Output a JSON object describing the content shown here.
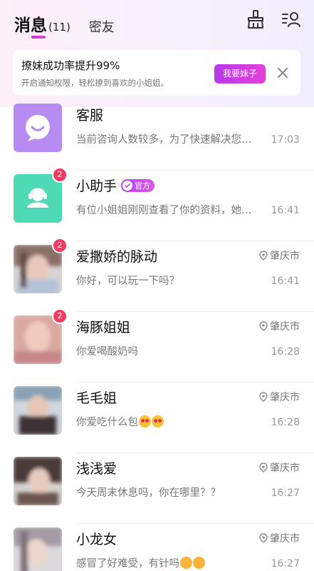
{
  "header": {
    "tab_messages": "消息",
    "tab_messages_count": "(11)",
    "tab_friends": "密友"
  },
  "banner": {
    "title": "撩妹成功率提升99%",
    "subtitle": "开启通知权限，轻松撩到喜欢的小姐姐。",
    "button": "我要妹子"
  },
  "official_badge": "官方",
  "conversations": [
    {
      "name": "客服",
      "preview": "当前咨询人数较多，为了快速解决您…",
      "time": "17:03",
      "badge": "",
      "location": ""
    },
    {
      "name": "小助手",
      "preview": "有位小姐姐刚刚查看了你的资料，她…",
      "time": "16:41",
      "badge": "2",
      "location": ""
    },
    {
      "name": "爱撒娇的脉动",
      "preview": "你好，可以玩一下吗？",
      "time": "16:41",
      "badge": "2",
      "location": "肇庆市"
    },
    {
      "name": "海豚姐姐",
      "preview": "你爱喝酸奶吗",
      "time": "16:28",
      "badge": "2",
      "location": "肇庆市"
    },
    {
      "name": "毛毛姐",
      "preview": "你爱吃什么包",
      "time": "16:28",
      "badge": "",
      "location": "肇庆市"
    },
    {
      "name": "浅浅爱",
      "preview": "今天周末休息吗，你在哪里？？",
      "time": "16:27",
      "badge": "",
      "location": "肇庆市"
    },
    {
      "name": "小龙女",
      "preview": "感冒了好难受，有针吗",
      "time": "16:27",
      "badge": "",
      "location": "肇庆市"
    }
  ],
  "colors": {
    "accent": "#d33fe0",
    "badge": "#f23b5f",
    "kefu_avatar": "#b78cf2",
    "assistant_avatar": "#4fd9b5"
  }
}
